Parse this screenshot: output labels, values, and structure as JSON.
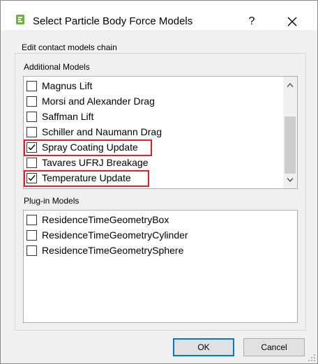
{
  "window": {
    "title": "Select Particle Body Force Models",
    "help_label": "?",
    "close_icon": "close-icon",
    "app_icon": "app-icon"
  },
  "group": {
    "legend": "Edit contact models chain"
  },
  "additional_models": {
    "label": "Additional Models",
    "items": [
      {
        "label": "Magnus Lift",
        "checked": false
      },
      {
        "label": "Morsi and Alexander Drag",
        "checked": false
      },
      {
        "label": "Saffman Lift",
        "checked": false
      },
      {
        "label": "Schiller and Naumann Drag",
        "checked": false
      },
      {
        "label": "Spray Coating Update",
        "checked": true
      },
      {
        "label": "Tavares UFRJ Breakage",
        "checked": false
      },
      {
        "label": "Temperature Update",
        "checked": true
      }
    ],
    "scroll_up_icon": "chevron-up-icon",
    "scroll_down_icon": "chevron-down-icon"
  },
  "plugin_models": {
    "label": "Plug-in Models",
    "items": [
      {
        "label": "ResidenceTimeGeometryBox",
        "checked": false
      },
      {
        "label": "ResidenceTimeGeometryCylinder",
        "checked": false
      },
      {
        "label": "ResidenceTimeGeometrySphere",
        "checked": false
      }
    ]
  },
  "buttons": {
    "ok": "OK",
    "cancel": "Cancel"
  },
  "colors": {
    "highlight": "#e0202a",
    "default_button_border": "#0078d7"
  }
}
